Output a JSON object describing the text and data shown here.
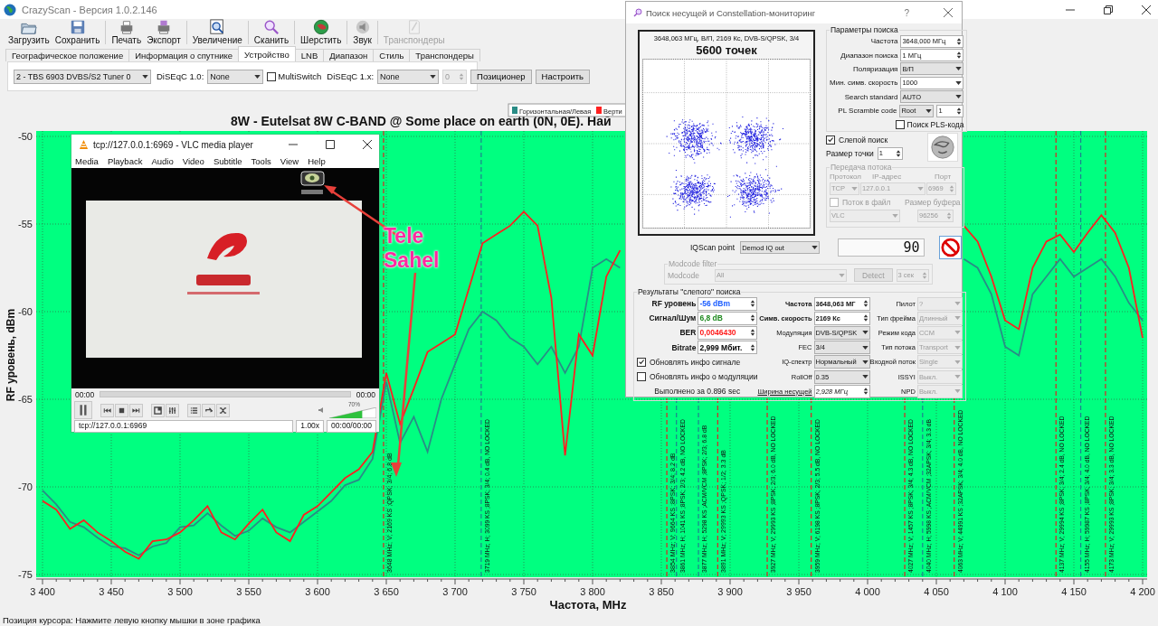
{
  "app": {
    "title": "CrazyScan - Версия 1.0.2.146"
  },
  "toolbar": [
    {
      "label": "Загрузить",
      "disabled": false
    },
    {
      "label": "Сохранить",
      "disabled": false
    },
    {
      "label": "Печать",
      "disabled": false
    },
    {
      "label": "Экспорт",
      "disabled": false
    },
    {
      "label": "Увеличение",
      "disabled": false
    },
    {
      "label": "Сканить",
      "disabled": false
    },
    {
      "label": "Шерстить",
      "disabled": false
    },
    {
      "label": "Звук",
      "disabled": false
    },
    {
      "label": "Транспондеры",
      "disabled": true
    }
  ],
  "tabs": [
    {
      "label": "Географическое положение",
      "selected": false
    },
    {
      "label": "Информация о спутнике",
      "selected": false
    },
    {
      "label": "Устройство",
      "selected": true
    },
    {
      "label": "LNB",
      "selected": false
    },
    {
      "label": "Диапазон",
      "selected": false
    },
    {
      "label": "Стиль",
      "selected": false
    },
    {
      "label": "Транспондеры",
      "selected": false
    }
  ],
  "device_panel": {
    "tuner": "2 - TBS 6903 DVBS/S2 Tuner 0",
    "diseqc10_label": "DiSEqC 1.0:",
    "diseqc10": "None",
    "multiswitch": {
      "label": "MultiSwitch",
      "checked": false
    },
    "diseqc1x_label": "DiSEqC 1.x:",
    "diseqc1x": "None",
    "port": {
      "value": "0",
      "disabled": true
    },
    "buttons": [
      "Позиционер",
      "Настроить"
    ]
  },
  "chart": {
    "chart_data": {
      "type": "line",
      "title": "8W - Eutelsat 8W C-BAND @ Some place on earth (0N, 0E). Най",
      "xlabel": "Частота, MHz",
      "ylabel": "RF уровень, dBm",
      "grid": true,
      "legend": "top",
      "x": [
        3400,
        3410,
        3420,
        3430,
        3440,
        3450,
        3460,
        3470,
        3480,
        3490,
        3500,
        3510,
        3520,
        3530,
        3540,
        3550,
        3560,
        3570,
        3580,
        3590,
        3600,
        3610,
        3620,
        3630,
        3640,
        3650,
        3660,
        3670,
        3680,
        3690,
        3700,
        3710,
        3720,
        3730,
        3740,
        3750,
        3760,
        3770,
        3780,
        3790,
        3800,
        3810,
        3820,
        3830,
        3840,
        3850,
        3860,
        3870,
        3880,
        3890,
        3900,
        3910,
        3920,
        3930,
        3940,
        3950,
        3960,
        3970,
        3980,
        3990,
        4000,
        4010,
        4020,
        4030,
        4040,
        4050,
        4060,
        4070,
        4080,
        4090,
        4100,
        4110,
        4120,
        4130,
        4140,
        4150,
        4160,
        4170,
        4180,
        4190,
        4200
      ],
      "series": [
        {
          "name": "Горизонтальная/Левая",
          "color": "#2a8c86",
          "values": [
            -70.2,
            -71.0,
            -72.0,
            -72.3,
            -72.9,
            -73.4,
            -73.5,
            -73.9,
            -73.4,
            -73.2,
            -72.3,
            -72.2,
            -71.5,
            -72.2,
            -72.8,
            -72.5,
            -71.8,
            -72.3,
            -72.6,
            -72.0,
            -71.4,
            -70.8,
            -69.9,
            -69.6,
            -68.4,
            -64.0,
            -67.5,
            -66.0,
            -68.0,
            -65.0,
            -63.0,
            -61.0,
            -60.0,
            -60.5,
            -61.5,
            -62.0,
            -63.0,
            -62.0,
            -63.5,
            -62.0,
            -57.5,
            -57.0,
            -57.5,
            null,
            null,
            null,
            null,
            null,
            null,
            null,
            null,
            null,
            null,
            null,
            null,
            null,
            null,
            null,
            null,
            null,
            null,
            null,
            null,
            null,
            null,
            null,
            null,
            -57.0,
            -57.5,
            -59.0,
            -62.0,
            -62.5,
            -59.0,
            -58.0,
            -57.0,
            -58.0,
            -57.5,
            -57.0,
            -58.0,
            -59.5,
            -60.5
          ]
        },
        {
          "name": "Верти",
          "color": "#ff2020",
          "values": [
            -70.8,
            -71.3,
            -72.4,
            -71.9,
            -72.6,
            -73.1,
            -73.7,
            -74.1,
            -73.1,
            -73.0,
            -72.6,
            -71.9,
            -71.1,
            -72.6,
            -73.0,
            -72.1,
            -71.3,
            -72.6,
            -73.1,
            -71.6,
            -71.1,
            -70.3,
            -69.5,
            -69.0,
            -68.0,
            -63.5,
            -66.4,
            -64.4,
            -62.3,
            -61.8,
            -61.3,
            -58.7,
            -56.1,
            -55.6,
            -55.1,
            -54.3,
            -55.1,
            -59.2,
            -68.2,
            -61.3,
            -62.5,
            -58.0,
            -56.5,
            null,
            null,
            null,
            null,
            null,
            null,
            null,
            null,
            null,
            null,
            null,
            null,
            null,
            null,
            null,
            null,
            null,
            null,
            null,
            null,
            null,
            null,
            null,
            null,
            -55.1,
            -56.0,
            -58.0,
            -60.5,
            -61.0,
            -57.5,
            -56.0,
            -55.6,
            -56.6,
            -55.5,
            -54.5,
            -55.5,
            -57.5,
            -61.5
          ]
        }
      ],
      "xlim": [
        3400,
        4200
      ],
      "ylim": [
        -75,
        -50
      ],
      "xticks": [
        {
          "value": 3400,
          "label": "3 400"
        },
        {
          "value": 3450,
          "label": "3 450"
        },
        {
          "value": 3500,
          "label": "3 500"
        },
        {
          "value": 3550,
          "label": "3 550"
        },
        {
          "value": 3600,
          "label": "3 600"
        },
        {
          "value": 3650,
          "label": "3 650"
        },
        {
          "value": 3700,
          "label": "3 700"
        },
        {
          "value": 3750,
          "label": "3 750"
        },
        {
          "value": 3800,
          "label": "3 800"
        },
        {
          "value": 3850,
          "label": "3 850"
        },
        {
          "value": 3900,
          "label": "3 900"
        },
        {
          "value": 3950,
          "label": "3 950"
        },
        {
          "value": 4000,
          "label": "4 000"
        },
        {
          "value": 4050,
          "label": "4 050"
        },
        {
          "value": 4100,
          "label": "4 100"
        },
        {
          "value": 4150,
          "label": "4 150"
        },
        {
          "value": 4200,
          "label": "4 200"
        }
      ],
      "yticks": [
        -50,
        -55,
        -60,
        -65,
        -70,
        -75
      ],
      "ref_lines": [
        {
          "axis": "x",
          "value": 3648,
          "color": "#e02020"
        },
        {
          "axis": "x",
          "value": 3719,
          "color": "#1f7f8f"
        },
        {
          "axis": "x",
          "value": 3854,
          "color": "#e02020"
        },
        {
          "axis": "x",
          "value": 3861,
          "color": "#1f7f8f"
        },
        {
          "axis": "x",
          "value": 3877,
          "color": "#1f7f8f"
        },
        {
          "axis": "x",
          "value": 3891,
          "color": "#e02020"
        },
        {
          "axis": "x",
          "value": 3927,
          "color": "#e02020"
        },
        {
          "axis": "x",
          "value": 3959,
          "color": "#e02020"
        },
        {
          "axis": "x",
          "value": 4027,
          "color": "#e02020"
        },
        {
          "axis": "x",
          "value": 4040,
          "color": "#1f7f8f"
        },
        {
          "axis": "x",
          "value": 4063,
          "color": "#e02020"
        },
        {
          "axis": "x",
          "value": 4137,
          "color": "#e02020"
        },
        {
          "axis": "x",
          "value": 4155,
          "color": "#1f7f8f"
        },
        {
          "axis": "x",
          "value": 4173,
          "color": "#e02020"
        }
      ],
      "annotations": [
        "3648 MHz; V; 2169 KS ;QPSK; 3/4; 6.8 dB",
        "3719 MHz; H; 3099 KS ;8PSK; 3/4; 0.4 dB, NO LOCKED",
        "3854 MHz; V; 9664 KS ;8PSK; 3/4; 8.2 dB",
        "3861 MHz; H; 1041 KS ;8PSK; 2/3; 4.2 dB, NO LOCKED",
        "3877 MHz; H; 5298 KS ;ACM/VCM ;8PSK; 2/3; 6.8 dB",
        "3891 MHz; V; 29993 KS ;QPSK; 1/2; 3.3 dB",
        "3927 MHz; V; 29993 KS ;8PSK; 2/3; 6.0 dB, NO LOCKED",
        "3959 MHz; V; 6198 KS ;8PSK; 2/3; 5.5 dB, NO LOCKED",
        "4027 MHz; V; 1457 KS ;8PSK; 3/4; 4.3 dB, NO LOCKED",
        "4040 MHz; H; 5998 KS ;ACM/VCM ;32APSK; 3/4; 3.3 dB",
        "4063 MHz; V; 44991 KS ;32APSK; 3/4; 4.0 dB, NO LOCKED",
        "4137 MHz; V; 29994 KS ;8PSK; 3/4; 2.4 dB, NO LOCKED",
        "4155 MHz; H; 59987 KS ;8PSK; 3/4; 4.0 dB, NO LOCKED",
        "4173 MHz; V; 29993 KS ;8PSK; 3/4; 3.3 dB, NO LOCKED"
      ]
    }
  },
  "vlc": {
    "title": "tcp://127.0.0.1:6969 - VLC media player",
    "menu": [
      "Media",
      "Playback",
      "Audio",
      "Video",
      "Subtitle",
      "Tools",
      "View",
      "Help"
    ],
    "video": {
      "kind": "picture"
    },
    "elapsed": "00:00",
    "total": "00:00",
    "volume_label": "70%",
    "volume": {
      "level": 0.7
    },
    "url": "tcp://127.0.0.1:6969",
    "speed": "1.00x",
    "time": "00:00/00:00"
  },
  "dialog": {
    "title": "Поиск несущей и Constellation-мониторинг",
    "help": "?",
    "constellation": {
      "header": "3648,063 МГц, В/П, 2169 Кс, DVB-S/QPSK, 3/4",
      "points": "5600 точек"
    },
    "search_params": {
      "title": "Параметры поиска",
      "fields": [
        {
          "label": "Частота",
          "value": "3648,000 МГц",
          "kind": "spin"
        },
        {
          "label": "Диапазон поиска",
          "value": "1 МГц",
          "kind": "spin"
        },
        {
          "label": "Поляризация",
          "value": "В/П",
          "kind": "select"
        },
        {
          "label": "Мин. симв. скорость",
          "value": "1000",
          "kind": "combo"
        },
        {
          "label": "Search standard",
          "value": "AUTO",
          "kind": "select"
        },
        {
          "label": "PL Scramble code",
          "value": "Root",
          "extra": "1",
          "kind": "select_spin"
        }
      ],
      "pls": {
        "label": "Поиск PLS-кода",
        "checked": false
      }
    },
    "blind": {
      "label": "Слепой поиск",
      "checked": true
    },
    "dot_size": {
      "label": "Размер точки",
      "value": "1"
    },
    "stream": {
      "title": "Передача потока",
      "disabled": true,
      "protocol_label": "Протокол",
      "ip_label": "IP-адрес",
      "port_label": "Порт",
      "protocol": "TCP",
      "ip": "127.0.0.1",
      "port": "6969",
      "to_file": {
        "label": "Поток в файл",
        "checked": false
      },
      "buffer_label": "Размер буфера",
      "player": "VLC",
      "buffer": "96256"
    },
    "iqscan": {
      "label": "IQScan point",
      "value": "Demod IQ out"
    },
    "counter": "90",
    "modcode": {
      "title": "Modcode filter",
      "label": "Modcode",
      "value": "All",
      "detect": "Detect",
      "timeout": "3 сек",
      "disabled": true
    },
    "results": {
      "title": "Результаты \"слепого\" поиска",
      "signal": [
        {
          "label": "RF уровень",
          "value": "-56 dBm",
          "color": "#1a5cff"
        },
        {
          "label": "Сигнал/Шум",
          "value": "6,8 dB",
          "color": "#208a20"
        },
        {
          "label": "BER",
          "value": "0,0046430",
          "color": "#ff1a1a"
        },
        {
          "label": "Bitrate",
          "value": "2,999 Мбит.",
          "color": "#000000"
        }
      ],
      "options": [
        {
          "label": "Обновлять инфо сигнале",
          "checked": true
        },
        {
          "label": "Обновлять инфо о модуляции",
          "checked": false
        }
      ],
      "elapsed": "Выполнено за 0.896 sec",
      "carrier": [
        {
          "label": "Частота",
          "value": "3648,063 МГ",
          "kind": "spin"
        },
        {
          "label": "Симв. скорость",
          "value": "2169 Кс",
          "kind": "spin"
        },
        {
          "label": "Модуляция",
          "value": "DVB-S/QPSK",
          "kind": "select"
        },
        {
          "label": "FEC",
          "value": "3/4",
          "kind": "select"
        },
        {
          "label": "IQ-спектр",
          "value": "Нормальный",
          "kind": "select"
        },
        {
          "label": "RollOff",
          "value": "0.35",
          "kind": "select"
        },
        {
          "label": "Ширина несущей",
          "value": "2,928 МГц",
          "kind": "link_spin"
        }
      ],
      "stream_info_disabled": true,
      "stream_info": [
        {
          "label": "Пилот",
          "value": "?"
        },
        {
          "label": "Тип фрейма",
          "value": "Длинный"
        },
        {
          "label": "Режим кода",
          "value": "CCM"
        },
        {
          "label": "Тип потока",
          "value": "Transport"
        },
        {
          "label": "Входной поток",
          "value": "Single"
        },
        {
          "label": "ISSYI",
          "value": "Выкл."
        },
        {
          "label": "NPD",
          "value": "Выкл."
        }
      ]
    }
  },
  "overlay_note": {
    "lines": [
      "Tele",
      "Sahel"
    ]
  },
  "status_bar": "Позиция курсора: Нажмите левую кнопку мышки в зоне графика"
}
